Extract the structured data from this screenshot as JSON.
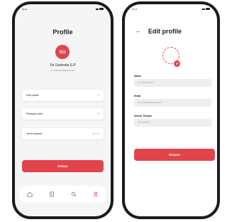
{
  "profile_screen": {
    "status_time": "09:41",
    "title": "Profile",
    "avatar_initials": "SU",
    "user_name": "Sri Usdevita S.P",
    "user_email": "sri.usdevita@gmail.com",
    "menu": [
      {
        "label": "Edit profile",
        "chevron": ">"
      },
      {
        "label": "Riwayat order",
        "chevron": ">"
      }
    ],
    "version_label": "Versi Android",
    "version_value": "V0.1.0",
    "logout_label": "Keluar",
    "tabs": [
      "home-icon",
      "orders-icon",
      "search-icon",
      "profile-icon"
    ]
  },
  "edit_screen": {
    "status_time": "09:41",
    "back_symbol": "←",
    "title": "Edit profile",
    "fields": [
      {
        "label": "Nama",
        "value": "Sri Usdevita S.P"
      },
      {
        "label": "Email",
        "value": "sri.usdevita@gmail.com"
      },
      {
        "label": "Nomor Telepon",
        "value": "0812345678"
      }
    ],
    "save_label": "Simpan"
  },
  "colors": {
    "accent": "#e2444c",
    "phone_frame": "#1b1b1b",
    "screen_bg": "#f5f5f5"
  }
}
